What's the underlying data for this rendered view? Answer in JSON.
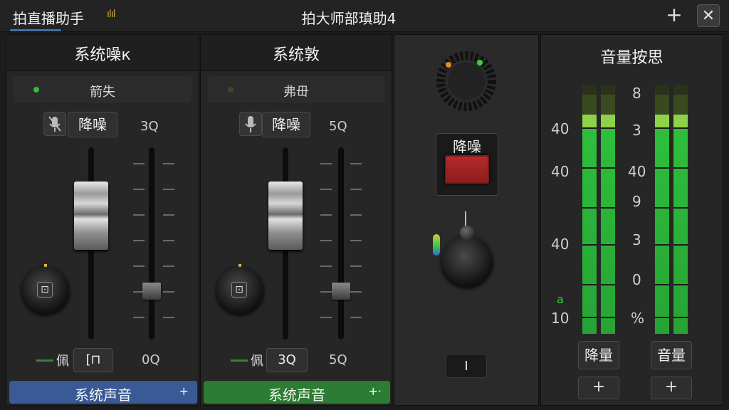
{
  "app": {
    "tab_title": "拍直播助手",
    "window_title": "拍大师部瑱助4"
  },
  "channels": [
    {
      "header": "系统噪к",
      "status_text": "箭失",
      "led_color": "#2fbf3a",
      "mode_label": "降噪",
      "mode_icon": "mic-slash-icon",
      "value_top": "3Q",
      "value_bottom": "0Q",
      "foot_label": "佩",
      "foot_value": "[⊓",
      "route_label": "系统声音",
      "route_color": "#3a5a96",
      "route_icon": "+"
    },
    {
      "header": "系统敦",
      "status_text": "弗毌",
      "led_color": "#3b4a26",
      "mode_label": "降噪",
      "mode_icon": "mic-icon",
      "value_top": "5Q",
      "value_bottom": "5Q",
      "foot_label": "佩",
      "foot_value": "3Q",
      "route_label": "系统声音",
      "route_color": "#2c7c33",
      "route_icon": "+·"
    }
  ],
  "center": {
    "button_label": "降噪",
    "button_color": "#b82b2b",
    "bottom_value": "I"
  },
  "meters": {
    "header": "音量按思",
    "left_scale": [
      "40",
      "40",
      "40",
      "10"
    ],
    "left_marker": "a",
    "right_scale": [
      "8",
      "3",
      "40",
      "9",
      "3",
      "0",
      "%"
    ],
    "left_group_level": 0.88,
    "right_group_level": 0.88,
    "button_left": "降量",
    "button_right": "音量",
    "plus_label": "+"
  }
}
